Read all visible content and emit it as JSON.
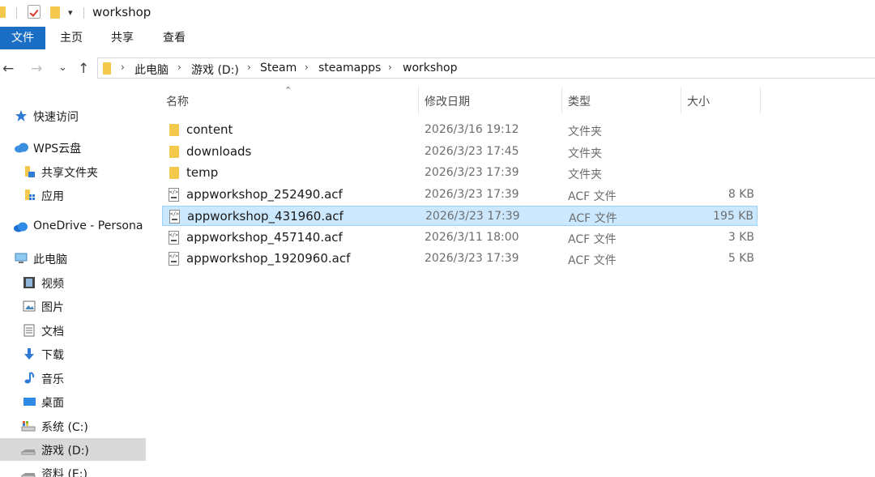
{
  "window": {
    "title": "workshop"
  },
  "ribbon": {
    "tabs": [
      "文件",
      "主页",
      "共享",
      "查看"
    ]
  },
  "nav": {
    "back": "←",
    "forward": "→",
    "recent": "⌄",
    "up": "↑",
    "breadcrumb": [
      "此电脑",
      "游戏 (D:)",
      "Steam",
      "steamapps",
      "workshop"
    ]
  },
  "sidebar": {
    "items": [
      {
        "label": "快速访问",
        "icon": "star-icon"
      },
      {
        "label": "WPS云盘",
        "icon": "cloud-icon"
      },
      {
        "label": "共享文件夹",
        "icon": "shared-folder-icon"
      },
      {
        "label": "应用",
        "icon": "apps-folder-icon"
      },
      {
        "label": "OneDrive - Persona",
        "icon": "onedrive-icon"
      },
      {
        "label": "此电脑",
        "icon": "computer-icon"
      },
      {
        "label": "视频",
        "icon": "video-icon"
      },
      {
        "label": "图片",
        "icon": "pictures-icon"
      },
      {
        "label": "文档",
        "icon": "documents-icon"
      },
      {
        "label": "下载",
        "icon": "download-icon"
      },
      {
        "label": "音乐",
        "icon": "music-icon"
      },
      {
        "label": "桌面",
        "icon": "desktop-icon"
      },
      {
        "label": "系统 (C:)",
        "icon": "system-drive-icon"
      },
      {
        "label": "游戏 (D:)",
        "icon": "drive-icon",
        "selected": true
      },
      {
        "label": "资料 (E:)",
        "icon": "drive-icon"
      }
    ]
  },
  "columns": {
    "name": "名称",
    "date": "修改日期",
    "type": "类型",
    "size": "大小"
  },
  "files": [
    {
      "name": "content",
      "date": "2026/3/16 19:12",
      "type": "文件夹",
      "size": "",
      "kind": "folder"
    },
    {
      "name": "downloads",
      "date": "2026/3/23 17:45",
      "type": "文件夹",
      "size": "",
      "kind": "folder"
    },
    {
      "name": "temp",
      "date": "2026/3/23 17:39",
      "type": "文件夹",
      "size": "",
      "kind": "folder"
    },
    {
      "name": "appworkshop_252490.acf",
      "date": "2026/3/23 17:39",
      "type": "ACF 文件",
      "size": "8 KB",
      "kind": "file"
    },
    {
      "name": "appworkshop_431960.acf",
      "date": "2026/3/23 17:39",
      "type": "ACF 文件",
      "size": "195 KB",
      "kind": "file",
      "selected": true
    },
    {
      "name": "appworkshop_457140.acf",
      "date": "2026/3/11 18:00",
      "type": "ACF 文件",
      "size": "3 KB",
      "kind": "file"
    },
    {
      "name": "appworkshop_1920960.acf",
      "date": "2026/3/23 17:39",
      "type": "ACF 文件",
      "size": "5 KB",
      "kind": "file"
    }
  ],
  "colors": {
    "accent": "#1a6fc4",
    "selection": "#cce8ff",
    "folder": "#f2c94c"
  }
}
